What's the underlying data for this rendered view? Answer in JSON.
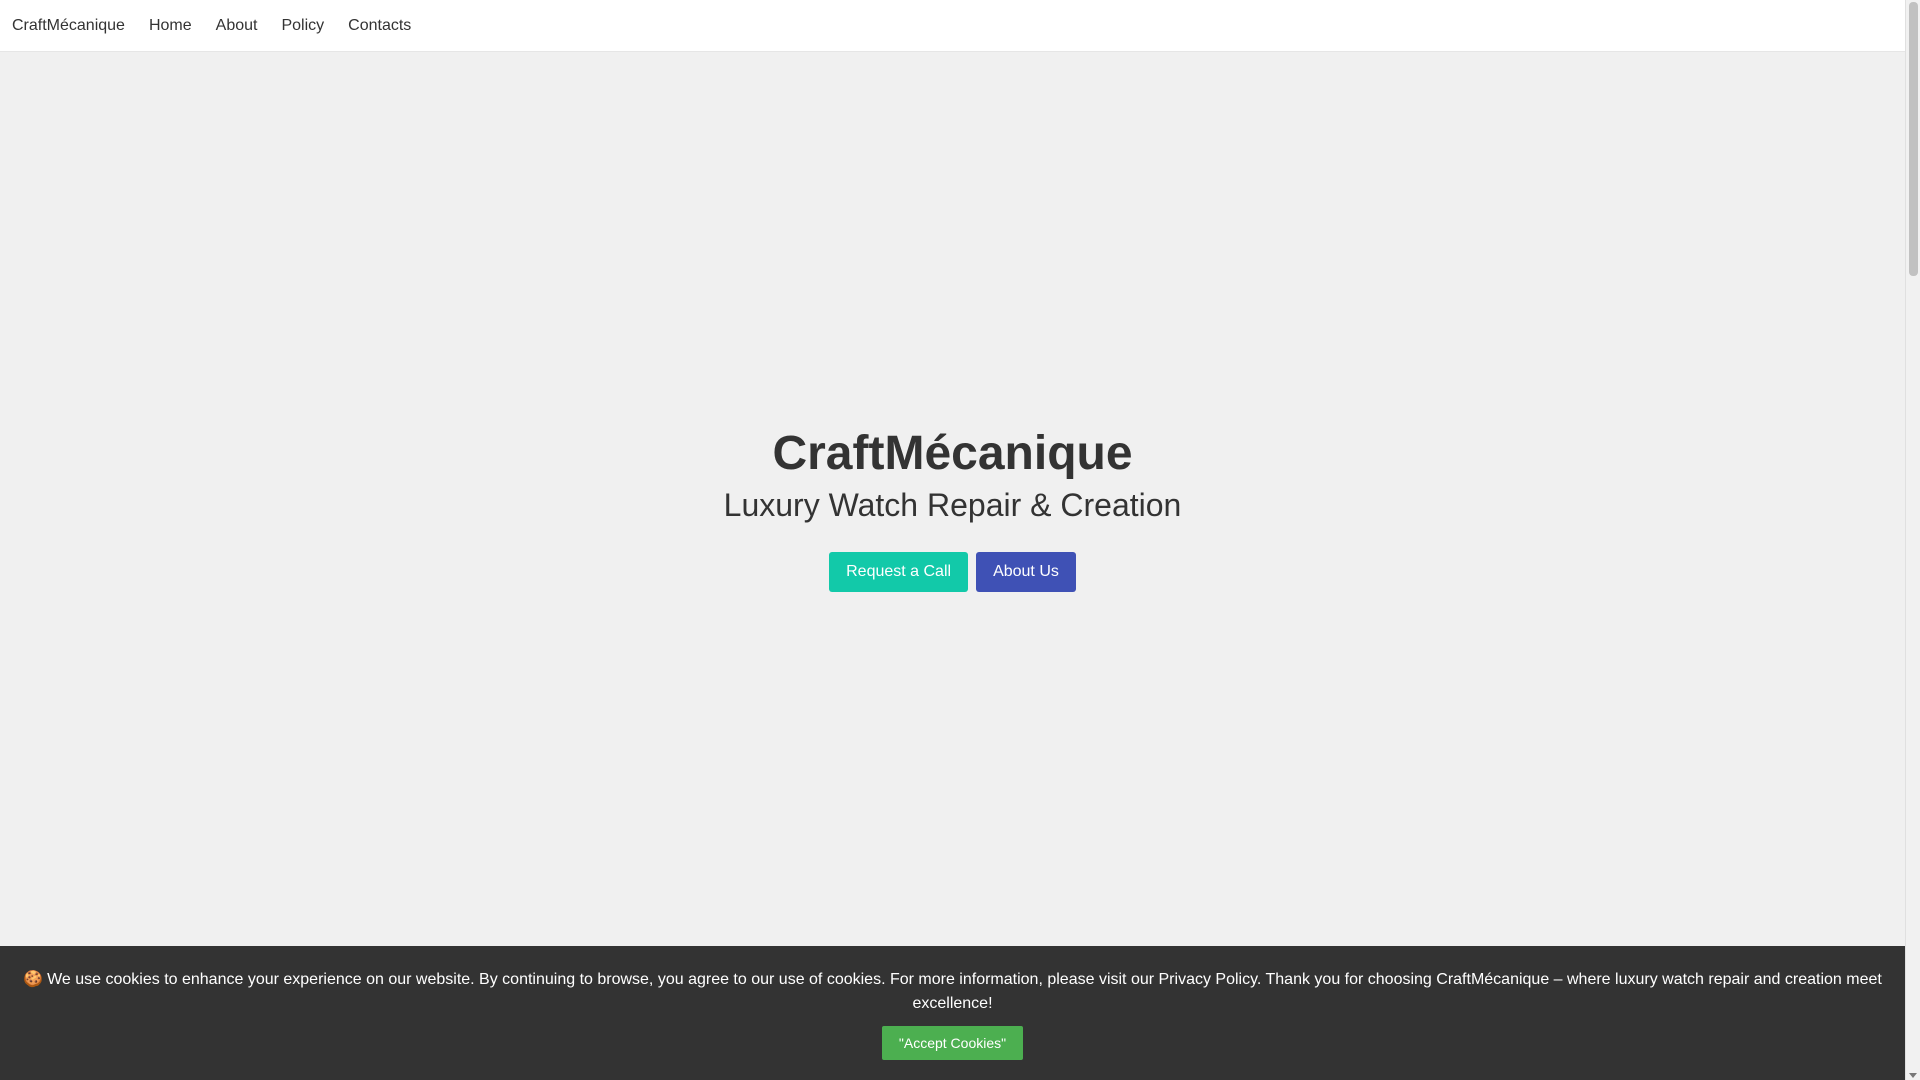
{
  "nav": {
    "brand": "CraftMécanique",
    "links": [
      "Home",
      "About",
      "Policy",
      "Contacts"
    ]
  },
  "hero": {
    "title": "CraftMécanique",
    "subtitle": "Luxury Watch Repair & Creation",
    "request_call_label": "Request a Call",
    "about_us_label": "About Us"
  },
  "cookie": {
    "icon": "🍪",
    "text": "We use cookies to enhance your experience on our website. By continuing to browse, you agree to our use of cookies. For more information, please visit our Privacy Policy. Thank you for choosing CraftMécanique – where luxury watch repair and creation meet excellence!",
    "accept_label": "\"Accept Cookies\""
  },
  "colors": {
    "background": "#f0f0f0",
    "primary_teal": "#12c9a9",
    "primary_indigo": "#3f51b5",
    "cookie_bg": "#333333",
    "cookie_button": "#4caf50"
  }
}
